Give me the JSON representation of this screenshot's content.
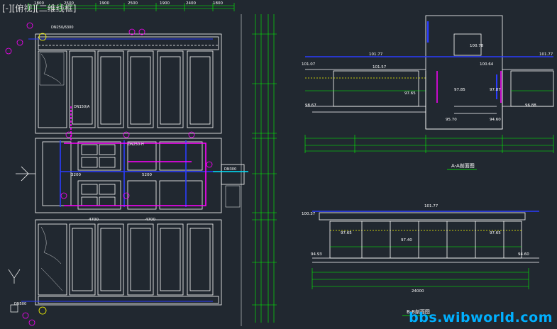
{
  "viewport": {
    "label": "[-][俯视][二维线框]"
  },
  "drawing": {
    "section_a_title": "A-A剖面图",
    "section_b_title": "B-B剖面图",
    "section_a_elevations": [
      "101.77",
      "101.57",
      "101.07",
      "100.78",
      "100.64",
      "101.77",
      "97.65",
      "97.85",
      "97.87",
      "98.67",
      "95.70",
      "94.60",
      "96.88"
    ],
    "section_b_elevations": [
      "100.37",
      "101.77",
      "97.65",
      "97.40",
      "94.93",
      "94.60",
      "97.65"
    ],
    "dim_widths": [
      "1800",
      "2500",
      "1900",
      "2500",
      "1900",
      "2400",
      "1800"
    ],
    "plan_dims": [
      "4700",
      "4700",
      "3200",
      "5200"
    ],
    "plan_pipe_labels": [
      "DN250/6300",
      "DN250-H",
      "DN300",
      "DN500",
      "DN150/A"
    ],
    "overall_length": "24000"
  },
  "watermark": {
    "text": "bbs.wibworld.com"
  },
  "colors": {
    "background": "#212830",
    "linework": "#ffffff",
    "dimension": "#00ff00",
    "pipe_blue": "#2a3cff",
    "pipe_magenta": "#ff00ff",
    "annotation_yellow": "#ffff00",
    "cyan": "#00e5ff",
    "watermark": "#00b0ff"
  }
}
